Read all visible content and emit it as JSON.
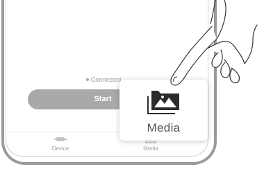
{
  "status": {
    "text": "Connected",
    "dot_color": "#a8a8a8"
  },
  "start_button": {
    "label": "Start",
    "color": "#a9a9a9"
  },
  "bottom_nav": {
    "items": [
      {
        "label": "Device",
        "icon": "device-icon"
      },
      {
        "label": "Media",
        "icon": "media-icon"
      }
    ]
  },
  "media_callout": {
    "label": "Media",
    "icon": "media-folder-icon"
  },
  "pointer": {
    "icon": "pointing-hand-icon"
  }
}
